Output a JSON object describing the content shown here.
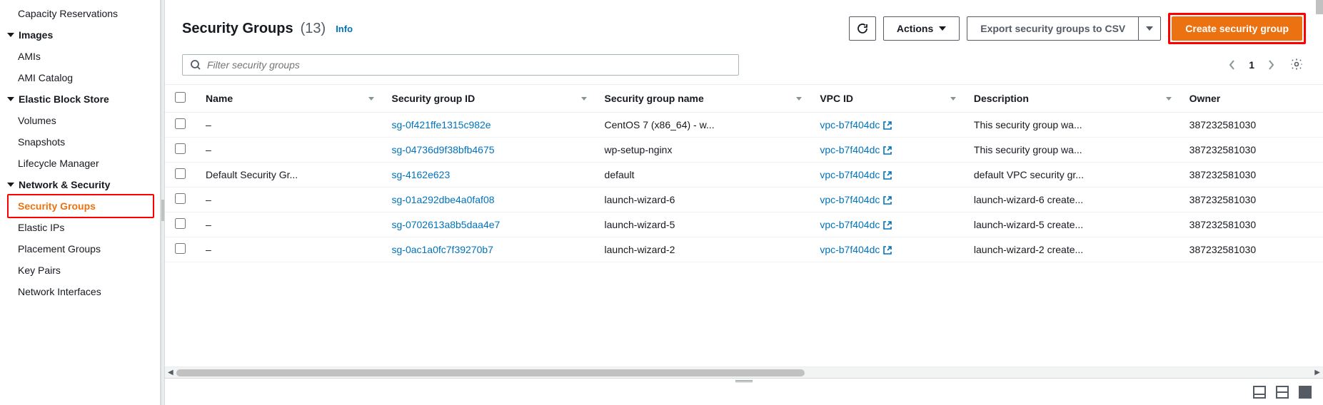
{
  "sidebar": {
    "items_top": [
      "Capacity Reservations"
    ],
    "sections": [
      {
        "label": "Images",
        "items": [
          "AMIs",
          "AMI Catalog"
        ]
      },
      {
        "label": "Elastic Block Store",
        "items": [
          "Volumes",
          "Snapshots",
          "Lifecycle Manager"
        ]
      },
      {
        "label": "Network & Security",
        "items": [
          "Security Groups",
          "Elastic IPs",
          "Placement Groups",
          "Key Pairs",
          "Network Interfaces"
        ]
      }
    ]
  },
  "header": {
    "title": "Security Groups",
    "count": "(13)",
    "info": "Info",
    "actions_label": "Actions",
    "export_label": "Export security groups to CSV",
    "create_label": "Create security group"
  },
  "filter": {
    "placeholder": "Filter security groups"
  },
  "pagination": {
    "page": "1"
  },
  "columns": [
    "Name",
    "Security group ID",
    "Security group name",
    "VPC ID",
    "Description",
    "Owner"
  ],
  "rows": [
    {
      "name": "–",
      "sgid": "sg-0f421ffe1315c982e",
      "sgname": "CentOS 7 (x86_64) - w...",
      "vpc": "vpc-b7f404dc",
      "desc": "This security group wa...",
      "owner": "387232581030"
    },
    {
      "name": "–",
      "sgid": "sg-04736d9f38bfb4675",
      "sgname": "wp-setup-nginx",
      "vpc": "vpc-b7f404dc",
      "desc": "This security group wa...",
      "owner": "387232581030"
    },
    {
      "name": "Default Security Gr...",
      "sgid": "sg-4162e623",
      "sgname": "default",
      "vpc": "vpc-b7f404dc",
      "desc": "default VPC security gr...",
      "owner": "387232581030"
    },
    {
      "name": "–",
      "sgid": "sg-01a292dbe4a0faf08",
      "sgname": "launch-wizard-6",
      "vpc": "vpc-b7f404dc",
      "desc": "launch-wizard-6 create...",
      "owner": "387232581030"
    },
    {
      "name": "–",
      "sgid": "sg-0702613a8b5daa4e7",
      "sgname": "launch-wizard-5",
      "vpc": "vpc-b7f404dc",
      "desc": "launch-wizard-5 create...",
      "owner": "387232581030"
    },
    {
      "name": "–",
      "sgid": "sg-0ac1a0fc7f39270b7",
      "sgname": "launch-wizard-2",
      "vpc": "vpc-b7f404dc",
      "desc": "launch-wizard-2 create...",
      "owner": "387232581030"
    }
  ]
}
